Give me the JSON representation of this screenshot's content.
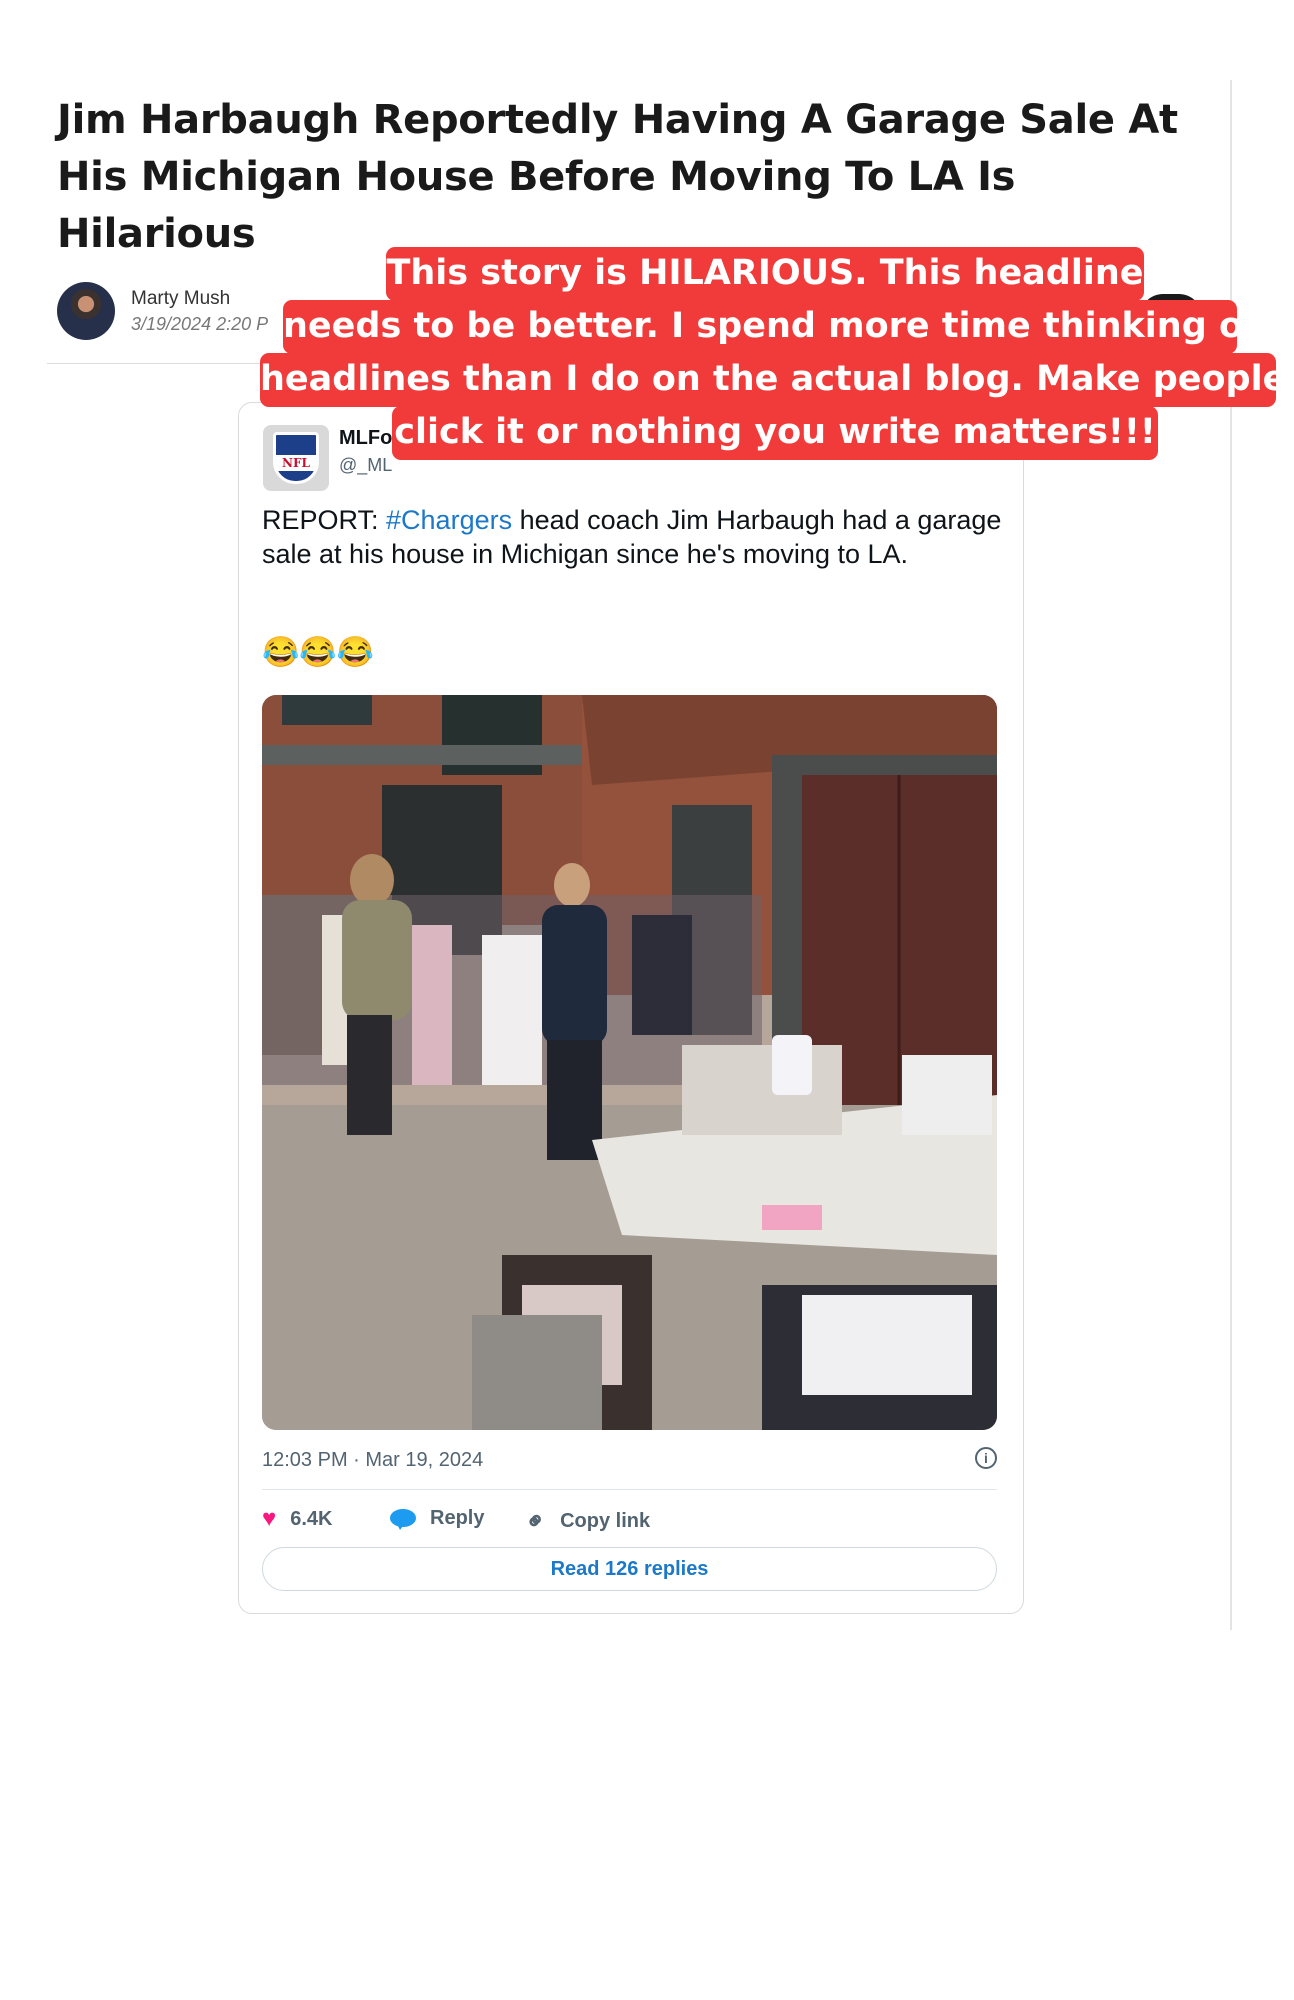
{
  "article": {
    "headline": "Jim Harbaugh Reportedly Having A Garage Sale At His Michigan House Before Moving To LA Is Hilarious",
    "author": "Marty Mush",
    "date": "3/19/2024 2:20 P"
  },
  "tweet": {
    "display_name": "MLFo",
    "handle": "@_ML",
    "text_prefix": "REPORT: ",
    "hashtag": "#Chargers",
    "text_suffix": " head coach Jim Harbaugh had a garage sale at his house in Michigan since he's moving to LA.",
    "emojis": "😂😂😂",
    "timestamp": "12:03 PM · Mar 19, 2024",
    "likes": "6.4K",
    "reply_label": "Reply",
    "copy_label": "Copy link",
    "read_replies": "Read 126 replies",
    "logo_text": "NFL"
  },
  "annotation": {
    "lines": [
      "This story is HILARIOUS. This headline",
      "needs to be better. I spend more time thinking of",
      "headlines than I do on the actual blog. Make people",
      "click it or nothing you write matters!!!"
    ],
    "color": "#f03b3a"
  },
  "icons": {
    "info": "info-icon",
    "heart": "heart-icon",
    "reply": "reply-bubble-icon",
    "link": "link-icon"
  }
}
